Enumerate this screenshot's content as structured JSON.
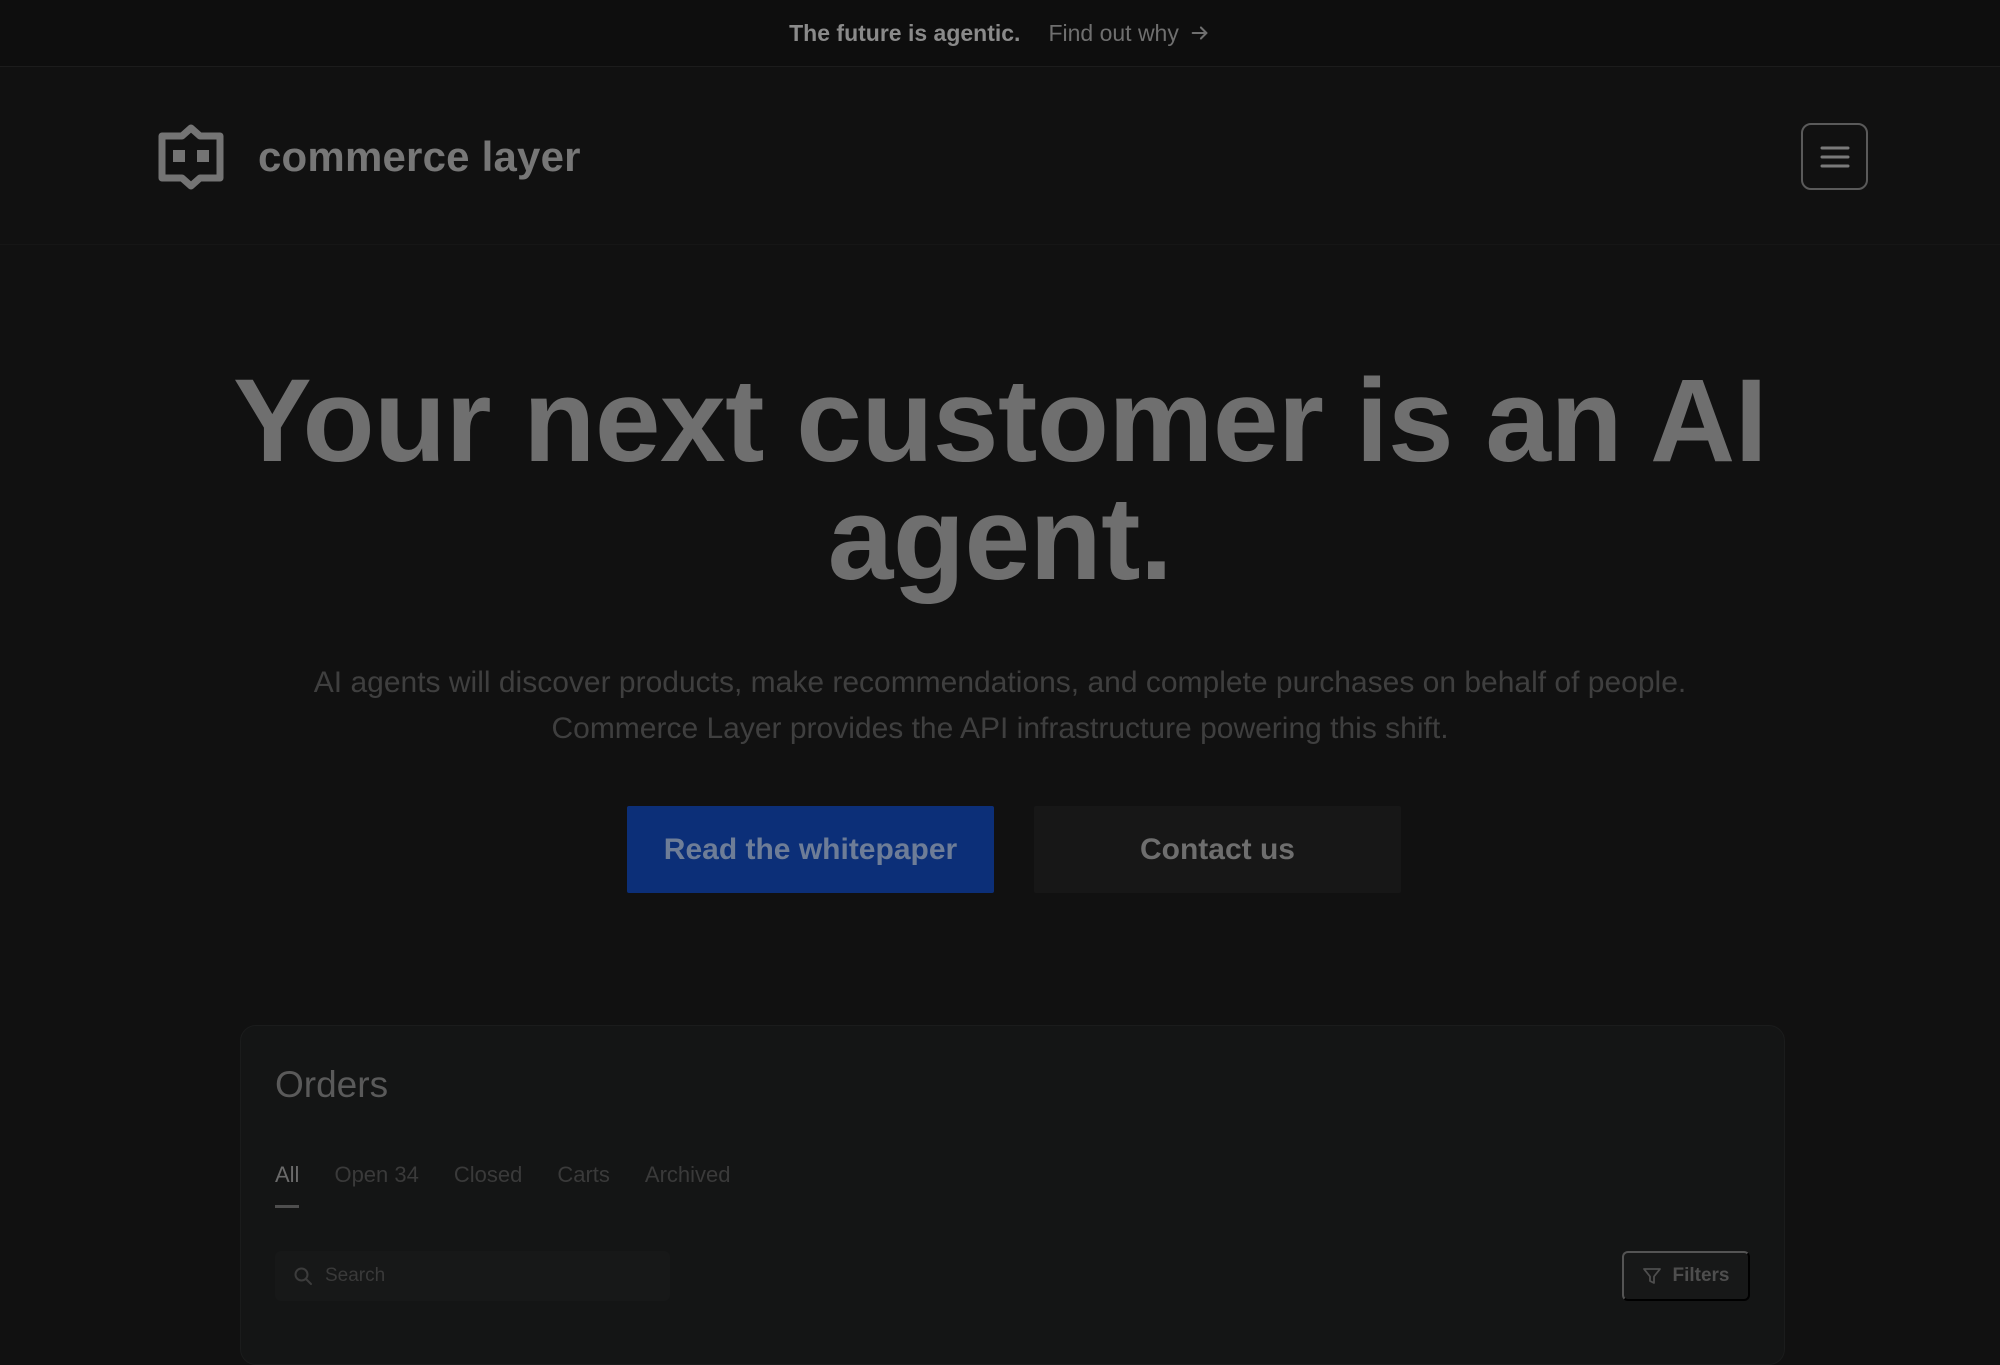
{
  "announcement": {
    "headline": "The future is agentic.",
    "link_label": "Find out why"
  },
  "header": {
    "brand": "commerce layer",
    "menu_icon": "hamburger-menu-icon"
  },
  "hero": {
    "title": "Your next customer is an AI agent.",
    "subtitle": "AI agents will discover products, make recommendations, and complete purchases on behalf of people. Commerce Layer provides the API infrastructure powering this shift.",
    "primary_cta": "Read the whitepaper",
    "secondary_cta": "Contact us"
  },
  "orders_panel": {
    "title": "Orders",
    "tabs": [
      {
        "label": "All",
        "active": true
      },
      {
        "label": "Open 34"
      },
      {
        "label": "Closed"
      },
      {
        "label": "Carts"
      },
      {
        "label": "Archived"
      }
    ],
    "search_placeholder": "Search",
    "filters_label": "Filters"
  },
  "colors": {
    "background": "#111111",
    "primary_button": "#0c2f78",
    "secondary_button": "#171717"
  }
}
